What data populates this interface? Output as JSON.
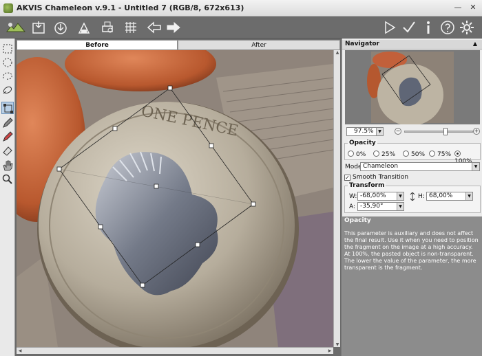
{
  "window": {
    "title": "AKVIS Chameleon v.9.1 - Untitled 7 (RGB/8, 672x613)",
    "minimize_glyph": "—",
    "close_glyph": "✕"
  },
  "toolbar": {
    "left_buttons": [
      "open-image-icon",
      "save-image-icon",
      "open-fragment-icon",
      "save-fragment-icon",
      "print-icon",
      "fragment-grid-icon",
      "undo-arrow-icon",
      "redo-arrow-icon"
    ],
    "right_buttons": [
      "run-icon",
      "apply-icon",
      "info-icon",
      "help-icon",
      "settings-gear-icon"
    ]
  },
  "tools": [
    "rect-selection-icon",
    "ellipse-selection-icon",
    "lasso-icon",
    "rotate-icon",
    "transform-icon",
    "pencil-icon",
    "pencil-alt-icon",
    "eraser-icon",
    "hand-icon",
    "zoom-icon"
  ],
  "tabs": {
    "before": "Before",
    "after": "After",
    "active": "before"
  },
  "navigator": {
    "title": "Navigator",
    "zoom": "97.5%",
    "zoom_minus": "−",
    "zoom_plus": "+"
  },
  "opacity": {
    "title": "Opacity",
    "options": [
      "0%",
      "25%",
      "50%",
      "75%",
      "100%"
    ],
    "selected": "100%"
  },
  "mode": {
    "label": "Mode",
    "value": "Chameleon"
  },
  "smooth": {
    "label": "Smooth Transition",
    "checked": true,
    "check_glyph": "✓"
  },
  "transform": {
    "title": "Transform",
    "w_label": "W:",
    "w_value": "-68,00%",
    "h_label": "H:",
    "h_value": "68,00%",
    "a_label": "A:",
    "a_value": "-35,90°"
  },
  "help": {
    "title": "Opacity",
    "text": "This parameter is auxiliary and does not affect the final result. Use it when you need to position the fragment on the image at a high accuracy. At 100%, the pasted object is non-transparent. The lower the value of the parameter, the more transparent is the fragment."
  },
  "coin_text": "ONE PENCE",
  "colors": {
    "toolbar_bg": "#6c6c6c",
    "panel_bg": "#ececec",
    "help_bg": "#8c8c8c",
    "copper": "#c56a3d",
    "silver": "#c9c1b1"
  }
}
